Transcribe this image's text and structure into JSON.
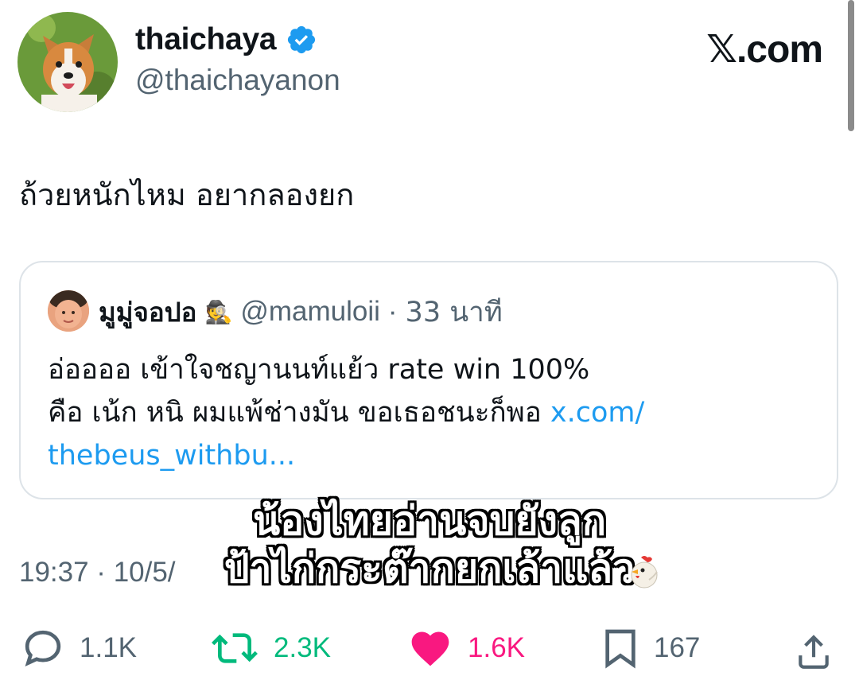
{
  "author": {
    "display_name": "thaichaya",
    "handle": "@thaichayanon",
    "verified": true,
    "avatar": "corgi-avatar"
  },
  "brand": {
    "text": "𝕏.com"
  },
  "tweet": {
    "text": "ถ้วยหนักไหม อยากลองยก",
    "timestamp": "19:37 · 10/5/"
  },
  "quote": {
    "display_name": "มูมู่จอปอ",
    "name_emoji": "🕵",
    "handle": "@mamuloii",
    "separator": "·",
    "time": "33 นาที",
    "line1": "อ่ออออ เข้าใจชญานนท์แย้ว rate win 100%",
    "line2": "คือ เน้ก หนิ ผมแพ้ช่างมัน ขอเธอชนะก็พอ ",
    "link_part1": "x.com/",
    "link_part2": "thebeus_withbu..."
  },
  "caption": {
    "line1": "น้องไทยอ่านจบยังลูก",
    "line2": "ป้าไก่กระต๊ากยกเล้าแล้ว",
    "emoji": "chicken-icon"
  },
  "actions": {
    "replies": "1.1K",
    "retweets": "2.3K",
    "likes": "1.6K",
    "bookmarks": "167"
  },
  "colors": {
    "accent": "#1d9bf0",
    "retweet": "#00ba7c",
    "like": "#f91880",
    "muted": "#536471"
  }
}
